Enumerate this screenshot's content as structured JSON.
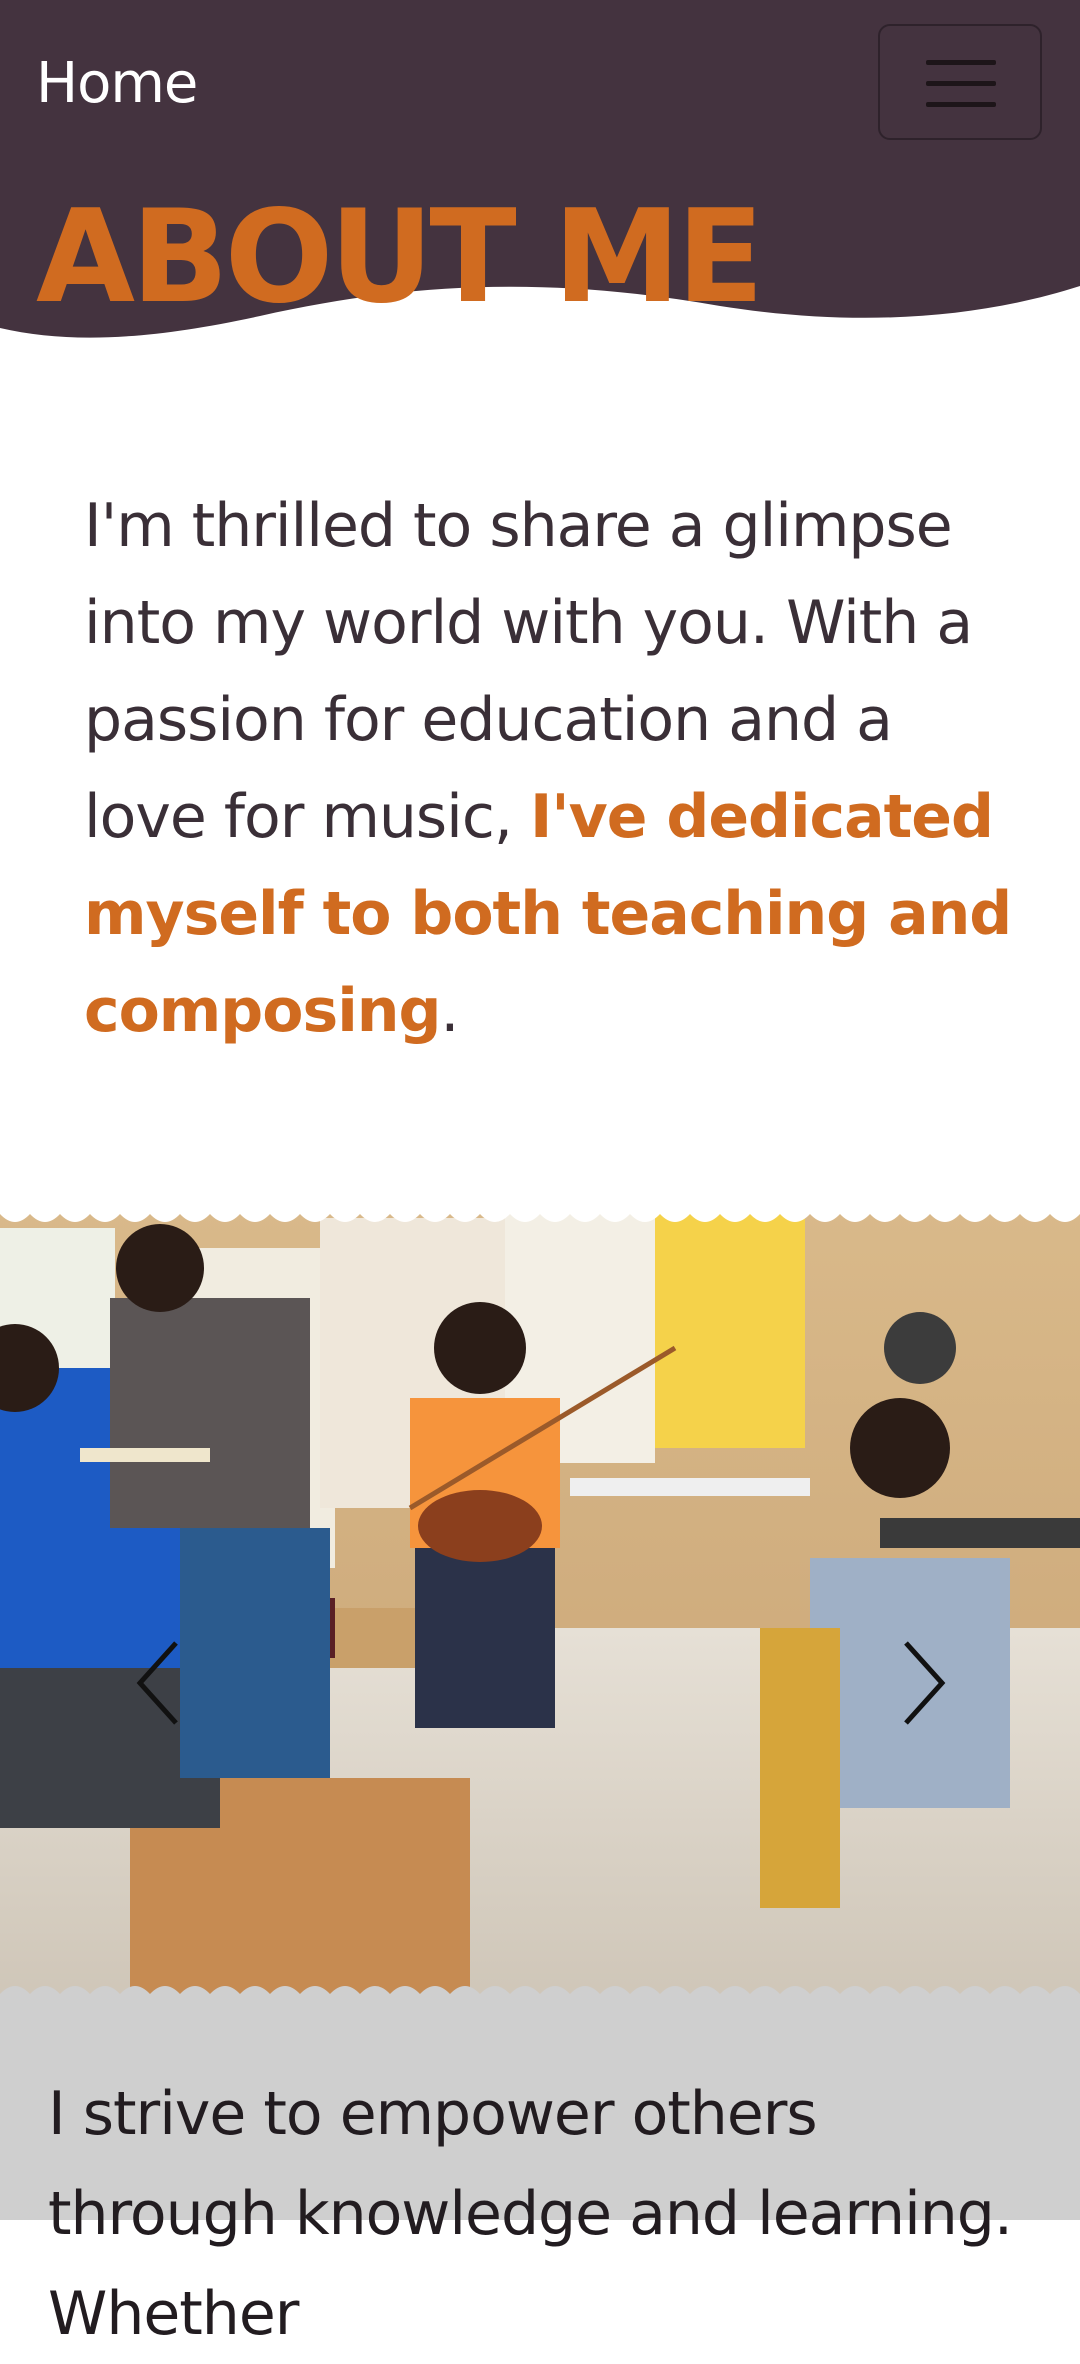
{
  "navbar": {
    "brand": "Home",
    "menu_icon": "hamburger-menu-icon"
  },
  "hero": {
    "title": "ABOUT ME"
  },
  "intro": {
    "text_before": "I'm thrilled to share a glimpse into my world with you. With a passion for education and a love for music, ",
    "highlight": "I've dedicated myself to both teaching and composing",
    "text_after": "."
  },
  "carousel": {
    "prev_icon": "chevron-left-icon",
    "next_icon": "chevron-right-icon"
  },
  "bottom": {
    "text": "I strive to empower others through knowledge and learning. Whether"
  },
  "colors": {
    "nav_bg": "#44333f",
    "accent": "#d06b20",
    "section_gray": "#cfcfcf"
  }
}
